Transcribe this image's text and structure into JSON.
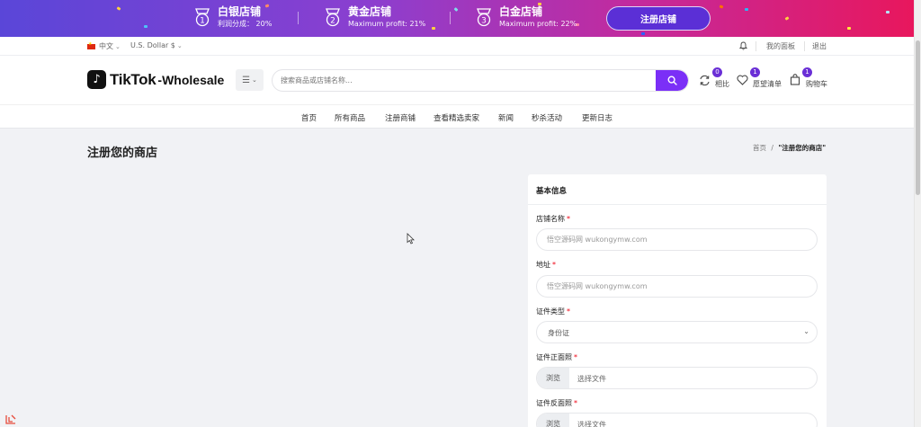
{
  "promo": {
    "tiers": [
      {
        "num": "1",
        "title": "白银店铺",
        "sub": "利润分成： 20%"
      },
      {
        "num": "2",
        "title": "黄金店铺",
        "sub": "Maximum profit: 21%"
      },
      {
        "num": "3",
        "title": "白金店铺",
        "sub": "Maximum profit: 22%"
      }
    ],
    "cta_label": "注册店铺"
  },
  "topbar": {
    "language": "中文",
    "currency": "U.S. Dollar $",
    "dashboard": "我的面板",
    "logout": "退出"
  },
  "header": {
    "logo_text": "TikTok",
    "logo_sub": "-Wholesale",
    "search_placeholder": "搜索商品或店铺名称...",
    "compare": {
      "label": "相比",
      "count": "0"
    },
    "wishlist": {
      "label": "愿望清单",
      "count": "1"
    },
    "cart": {
      "label": "购物车",
      "count": "1"
    }
  },
  "nav": {
    "items": [
      "首页",
      "所有商品",
      "注册商铺",
      "查看精选卖家",
      "新闻",
      "秒杀活动",
      "更新日志"
    ]
  },
  "page": {
    "title": "注册您的商店",
    "breadcrumb_home": "首页",
    "breadcrumb_sep": "/",
    "breadcrumb_current": "\"注册您的商店\""
  },
  "form": {
    "section_title": "基本信息",
    "shop_name_label": "店铺名称",
    "shop_name_placeholder": "悟空源码网 wukongymw.com",
    "address_label": "地址",
    "address_placeholder": "悟空源码网 wukongymw.com",
    "id_type_label": "证件类型",
    "id_type_value": "身份证",
    "front_label": "证件正面照",
    "back_label": "证件反面照",
    "browse_label": "浏览",
    "choose_file": "选择文件",
    "required_mark": "*"
  },
  "colors": {
    "accent": "#7b2ff7",
    "badge": "#6a2fd6",
    "required": "#ee1111",
    "banner_start": "#5a46d8",
    "banner_end": "#e8175d"
  }
}
